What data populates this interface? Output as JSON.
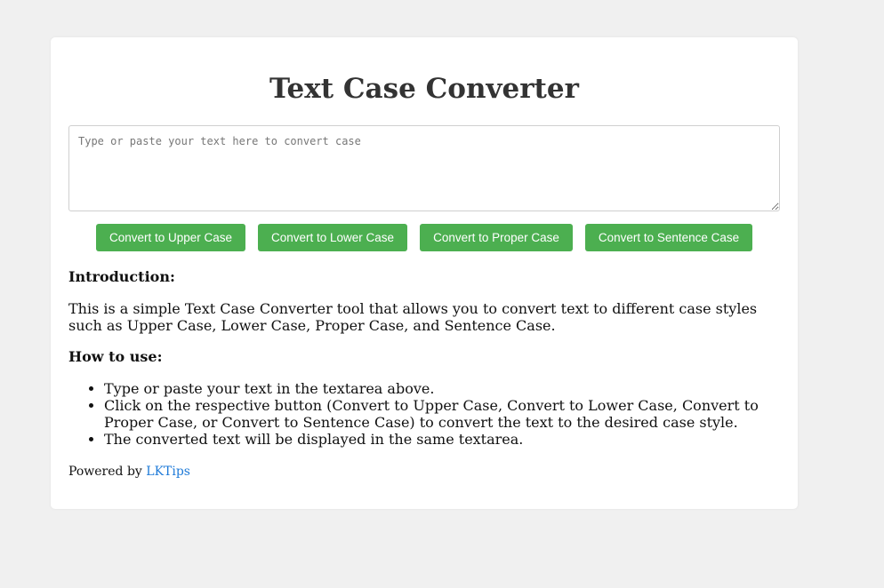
{
  "app": {
    "title": "Text Case Converter"
  },
  "editor": {
    "value": "",
    "placeholder": "Type or paste your text here to convert case"
  },
  "buttons": {
    "upper": "Convert to Upper Case",
    "lower": "Convert to Lower Case",
    "proper": "Convert to Proper Case",
    "sentence": "Convert to Sentence Case"
  },
  "intro": {
    "heading": "Introduction:",
    "text": "This is a simple Text Case Converter tool that allows you to convert text to different case styles such as Upper Case, Lower Case, Proper Case, and Sentence Case."
  },
  "how_to": {
    "heading": "How to use:",
    "steps": [
      "Type or paste your text in the textarea above.",
      "Click on the respective button (Convert to Upper Case, Convert to Lower Case, Convert to Proper Case, or Convert to Sentence Case) to convert the text to the desired case style.",
      "The converted text will be displayed in the same textarea."
    ]
  },
  "footer": {
    "powered_prefix": "Powered by",
    "link_text": "LKTips"
  },
  "colors": {
    "page_background": "#f0f0f0",
    "button_green": "#4caf50",
    "link_blue": "#1e7ad8",
    "title_text": "#333333"
  }
}
